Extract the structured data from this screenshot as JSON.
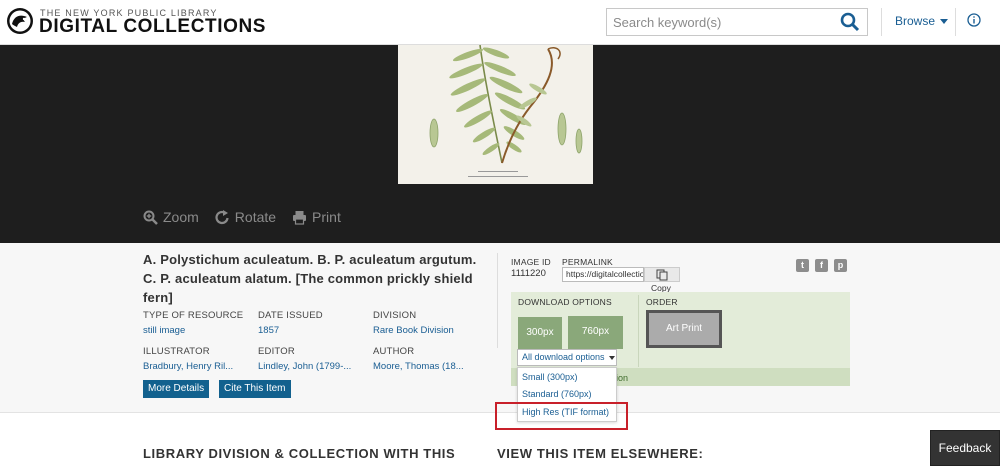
{
  "header": {
    "logo_sup": "THE NEW YORK PUBLIC LIBRARY",
    "logo_main": "DIGITAL COLLECTIONS",
    "search_placeholder": "Search keyword(s)",
    "browse_label": "Browse"
  },
  "viewer": {
    "tools": [
      {
        "label": "Zoom",
        "icon": "zoom-icon"
      },
      {
        "label": "Rotate",
        "icon": "rotate-icon"
      },
      {
        "label": "Print",
        "icon": "print-icon"
      }
    ]
  },
  "item": {
    "title": "A. Polystichum aculeatum. B. P. aculeatum argutum. C. P. aculeatum alatum. [The common prickly shield fern]",
    "meta": [
      {
        "label": "Type of Resource",
        "value": "still image"
      },
      {
        "label": "Date Issued",
        "value": "1857"
      },
      {
        "label": "Division",
        "value": "Rare Book Division"
      },
      {
        "label": "Illustrator",
        "value": "Bradbury, Henry Ril..."
      },
      {
        "label": "Editor",
        "value": "Lindley, John (1799-..."
      },
      {
        "label": "Author",
        "value": "Moore, Thomas (18..."
      }
    ],
    "more_details": "More Details",
    "cite_item": "Cite This Item"
  },
  "side": {
    "image_id_label": "IMAGE ID",
    "image_id": "1111220",
    "permalink_label": "PERMALINK",
    "permalink": "https://digitalcollectio",
    "copy_label": "Copy",
    "social": [
      "twitter-icon",
      "facebook-icon",
      "pinterest-icon"
    ],
    "download_label": "DOWNLOAD OPTIONS",
    "order_label": "ORDER",
    "dl_300": "300px",
    "dl_760": "760px",
    "art_print": "Art Print",
    "all_downloads": "All download options",
    "strip_text": "ion",
    "dropdown": [
      "Small (300px)",
      "Standard (760px)",
      "High Res (TIF format)"
    ]
  },
  "bottom": {
    "left_heading": "LIBRARY DIVISION & COLLECTION WITH THIS",
    "right_heading": "VIEW THIS ITEM ELSEWHERE:"
  },
  "feedback": "Feedback",
  "colors": {
    "link_blue": "#1a5e93",
    "button_blue": "#12618e",
    "download_green": "#8aa87a",
    "highlight_red": "#c8202a"
  }
}
